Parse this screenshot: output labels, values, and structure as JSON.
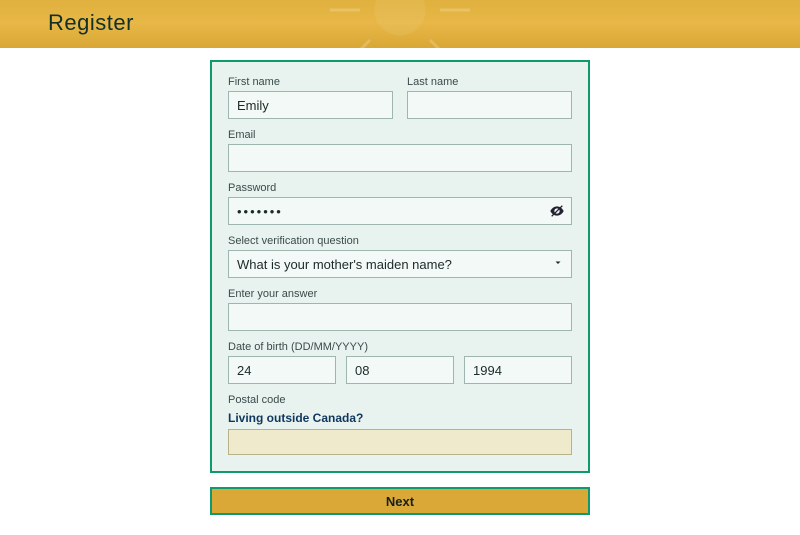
{
  "header": {
    "title": "Register"
  },
  "form": {
    "first_name": {
      "label": "First name",
      "value": "Emily"
    },
    "last_name": {
      "label": "Last name",
      "value": ""
    },
    "email": {
      "label": "Email",
      "value": ""
    },
    "password": {
      "label": "Password",
      "value": "•••••••"
    },
    "verif_q_label": "Select verification question",
    "verif_q_value": "What is your mother's maiden name?",
    "answer_label": "Enter your answer",
    "answer_value": "",
    "dob": {
      "label": "Date of birth (DD/MM/YYYY)",
      "dd": "24",
      "mm": "08",
      "yyyy": "1994"
    },
    "postal_label": "Postal code",
    "outside_link": "Living outside Canada?",
    "postal_value": ""
  },
  "actions": {
    "next": "Next"
  }
}
